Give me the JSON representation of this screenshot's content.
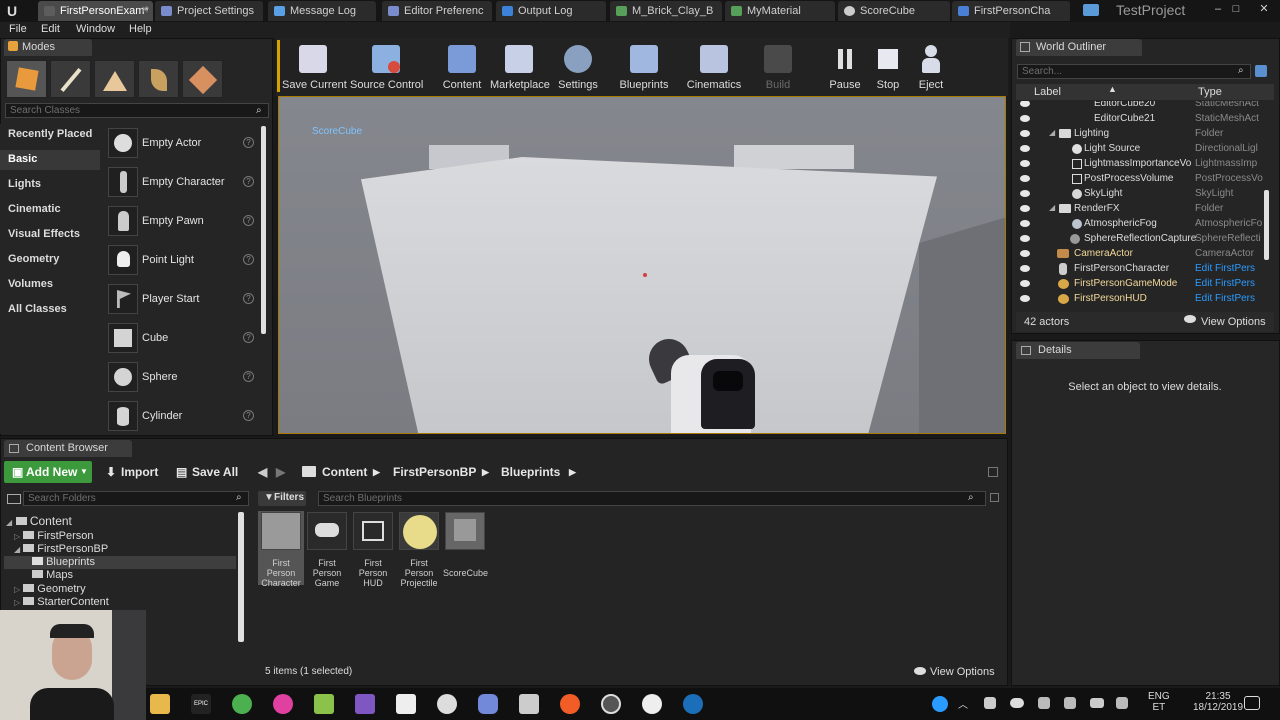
{
  "titlebar": {
    "tabs": [
      {
        "label": "FirstPersonExam*",
        "color": "#4a4a4a"
      },
      {
        "label": "Project Settings",
        "color": "#7b8ccc"
      },
      {
        "label": "Message Log",
        "color": "#5aa0e6"
      },
      {
        "label": "Editor Preferenc",
        "color": "#7b8ccc"
      },
      {
        "label": "Output Log",
        "color": "#3c82d8"
      },
      {
        "label": "M_Brick_Clay_B",
        "color": "#57a05a"
      },
      {
        "label": "MyMaterial",
        "color": "#57a05a"
      },
      {
        "label": "ScoreCube",
        "color": "#888888"
      },
      {
        "label": "FirstPersonCha",
        "color": "#4a7fd6"
      }
    ],
    "project": "TestProject"
  },
  "menu": [
    "File",
    "Edit",
    "Window",
    "Help"
  ],
  "modes": {
    "title": "Modes",
    "search_placeholder": "Search Classes",
    "categories": [
      "Recently Placed",
      "Basic",
      "Lights",
      "Cinematic",
      "Visual Effects",
      "Geometry",
      "Volumes",
      "All Classes"
    ],
    "items": [
      "Empty Actor",
      "Empty Character",
      "Empty Pawn",
      "Point Light",
      "Player Start",
      "Cube",
      "Sphere",
      "Cylinder"
    ]
  },
  "toolbar": [
    "Save Current",
    "Source Control",
    "Content",
    "Marketplace",
    "Settings",
    "Blueprints",
    "Cinematics",
    "Build",
    "Pause",
    "Stop",
    "Eject"
  ],
  "viewport": {
    "label": "ScoreCube"
  },
  "outliner": {
    "title": "World Outliner",
    "search_placeholder": "Search...",
    "col_label": "Label",
    "col_type": "Type",
    "rows": [
      {
        "name": "EditorCube20",
        "type": "StaticMeshAct"
      },
      {
        "name": "EditorCube21",
        "type": "StaticMeshAct"
      },
      {
        "name": "Lighting",
        "type": "Folder"
      },
      {
        "name": "Light Source",
        "type": "DirectionalLigl"
      },
      {
        "name": "LightmassImportanceVo",
        "type": "LightmassImp"
      },
      {
        "name": "PostProcessVolume",
        "type": "PostProcessVo"
      },
      {
        "name": "SkyLight",
        "type": "SkyLight"
      },
      {
        "name": "RenderFX",
        "type": "Folder"
      },
      {
        "name": "AtmosphericFog",
        "type": "AtmosphericFo"
      },
      {
        "name": "SphereReflectionCapture",
        "type": "SphereReflecti"
      },
      {
        "name": "CameraActor",
        "type": "CameraActor"
      },
      {
        "name": "FirstPersonCharacter",
        "type": "Edit FirstPers"
      },
      {
        "name": "FirstPersonGameMode",
        "type": "Edit FirstPers"
      },
      {
        "name": "FirstPersonHUD",
        "type": "Edit FirstPers"
      }
    ],
    "count": "42 actors",
    "view_options": "View Options"
  },
  "details": {
    "title": "Details",
    "empty": "Select an object to view details."
  },
  "content_browser": {
    "title": "Content Browser",
    "add_new": "Add New",
    "import": "Import",
    "save_all": "Save All",
    "crumbs": [
      "Content",
      "FirstPersonBP",
      "Blueprints"
    ],
    "search_folders": "Search Folders",
    "filters": "Filters",
    "search_assets": "Search Blueprints",
    "tree": [
      "Content",
      "FirstPerson",
      "FirstPersonBP",
      "Blueprints",
      "Maps",
      "Geometry",
      "StarterContent"
    ],
    "assets": [
      {
        "name": "First Person Character",
        "l1": "First",
        "l2": "Person",
        "l3": "Character"
      },
      {
        "name": "First Person Game",
        "l1": "First",
        "l2": "Person",
        "l3": "Game"
      },
      {
        "name": "First Person HUD",
        "l1": "First",
        "l2": "Person",
        "l3": "HUD"
      },
      {
        "name": "First Person Projectile",
        "l1": "First",
        "l2": "Person",
        "l3": "Projectile"
      },
      {
        "name": "ScoreCube",
        "l1": "ScoreCube",
        "l2": "",
        "l3": ""
      }
    ],
    "status": "5 items (1 selected)",
    "view_options": "View Options"
  },
  "taskbar": {
    "lang1": "ENG",
    "lang2": "ET",
    "time": "21:35",
    "date": "18/12/2019"
  }
}
